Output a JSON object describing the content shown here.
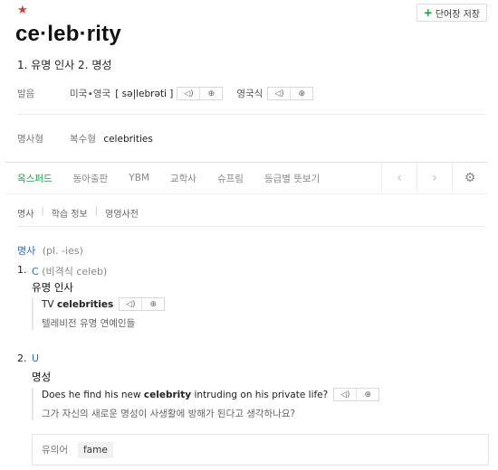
{
  "header": {
    "save_label": "단어장 저장",
    "headword": "ce·leb·rity",
    "short_meanings": "1. 유명 인사 2. 명성"
  },
  "pronunciation": {
    "label": "발음",
    "us_label": "미국∙영국",
    "us_ipa": "[ sə|lebrəti ]",
    "uk_label": "영국식"
  },
  "forms": {
    "label": "명사형",
    "prefix": "복수형",
    "value": "celebrities"
  },
  "tabs": [
    {
      "label": "옥스퍼드",
      "active": true
    },
    {
      "label": "동아출판"
    },
    {
      "label": "YBM"
    },
    {
      "label": "교학사"
    },
    {
      "label": "슈프림"
    },
    {
      "label": "등급별 뜻보기"
    }
  ],
  "subnav": [
    "명사",
    "학습 정보",
    "영영사전"
  ],
  "entry": {
    "pos": "명사",
    "pos_note": "(pl. -ies)",
    "senses": [
      {
        "num": "1.",
        "tag": "C",
        "tag_note": "(비격식 celeb)",
        "meaning": "유명 인사",
        "example_prefix": "TV ",
        "example_bold": "celebrities",
        "example_suffix": "",
        "example_ko": "텔레비전 유명 연예인들"
      },
      {
        "num": "2.",
        "tag": "U",
        "meaning": "명성",
        "example_prefix": "Does he find his new ",
        "example_bold": "celebrity",
        "example_suffix": " intruding on his private life?",
        "example_ko": "그가 자신의 새로운 명성이 사생활에 방해가 된다고 생각하나요?"
      }
    ],
    "synonym_label": "유의어",
    "synonym": "fame"
  },
  "icons": {
    "star": "star-icon",
    "sound": "speaker-icon",
    "speed": "slow-play-icon",
    "prev": "chevron-left-icon",
    "next": "chevron-right-icon",
    "settings": "gear-icon"
  },
  "colors": {
    "accent": "#1aa152",
    "star": "#d43b3b",
    "link": "#2a6ebd"
  }
}
